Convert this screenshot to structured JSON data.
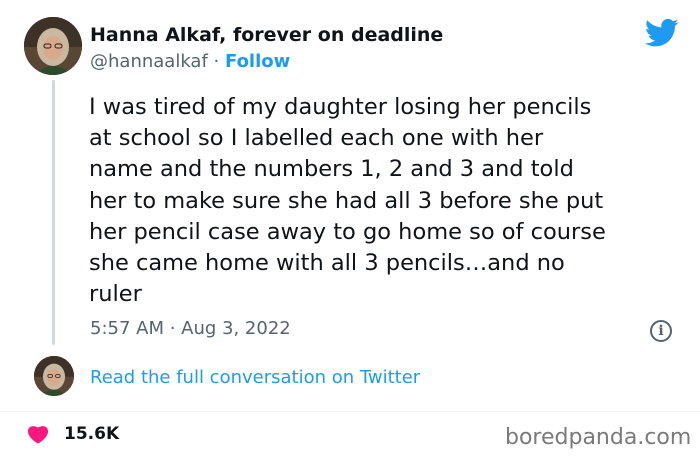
{
  "author": {
    "name": "Hanna Alkaf, forever on deadline",
    "handle": "@hannaalkaf",
    "separator": "·",
    "follow_label": "Follow"
  },
  "tweet": {
    "text": "I was tired of my daughter losing her pencils\nat school so I labelled each one with her\nname and the numbers 1, 2 and 3 and told\nher to make sure she had all 3 before she put\nher pencil case away to go home so of course\nshe came home with all 3 pencils…and no\nruler",
    "timestamp": "5:57 AM · Aug 3, 2022"
  },
  "conversation_link": "Read the full conversation on Twitter",
  "likes": "15.6K",
  "watermark": "boredpanda.com",
  "icons": {
    "brand": "twitter-bird-icon",
    "info": "info-icon",
    "like": "heart-icon"
  },
  "colors": {
    "accent": "#1d9bf0",
    "heart": "#f91880",
    "text": "#0f1419",
    "muted": "#536471"
  }
}
